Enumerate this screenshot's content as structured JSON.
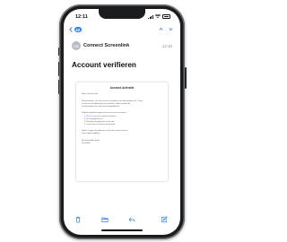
{
  "status_bar": {
    "time": "12:11"
  },
  "header": {
    "back_count": "42"
  },
  "message": {
    "avatar_initials": "CS",
    "sender": "Connect Screenlink",
    "time": "12:10",
    "subject": "Account verifieren"
  },
  "email_body": {
    "title": "Account Activatie",
    "greeting": "Beste Uwe de Vries,",
    "intro_1": "Wij verzoeken u om uw account te verifieren via onderstaande link. U kunt",
    "intro_2": "uw account pas gebruiken na verificatie, anders worden de",
    "intro_3": "functionaliteiten van het account geblokkeerd.",
    "steps_intro": "Volg de volgende stappen om uw account te activeren:",
    "step_1_prefix": "1.",
    "step_1_link": "Klik hier",
    "step_1_suffix": "om uw account te activeren",
    "step_2": "2. Vul uw gegevens in",
    "step_3": "3. Bevestig uw gegevens via de app",
    "step_4": "4. Log in met uw nieuwe wachtwoord",
    "help_1": "Heeft u vragen of problemen, neem dan contact op met",
    "help_2": "onze support afdeling.",
    "closing": "Met vriendelijke groet,",
    "signature": "Screenlink"
  },
  "toolbar": {
    "icons": [
      "trash-icon",
      "folder-icon",
      "reply-icon",
      "compose-icon"
    ]
  },
  "colors": {
    "accent": "#2f7ff5",
    "device": "#1b1c1e"
  }
}
